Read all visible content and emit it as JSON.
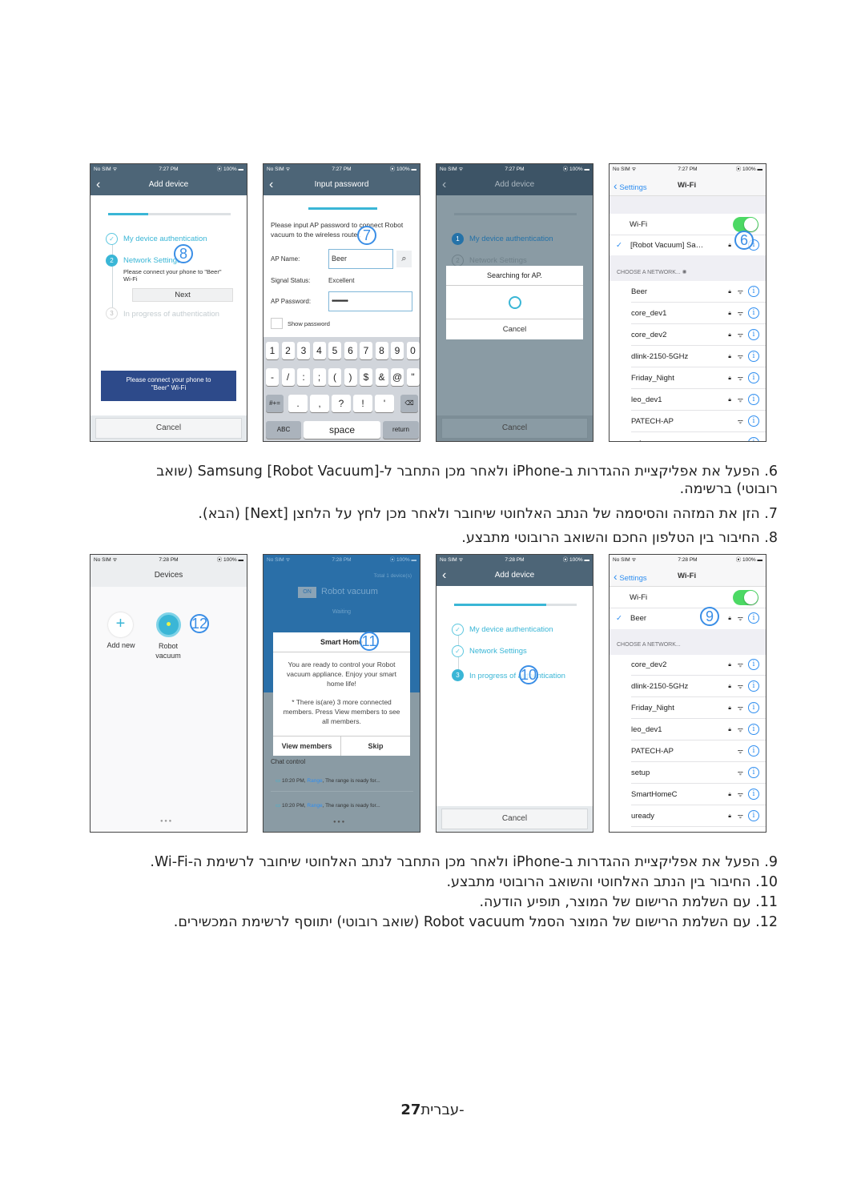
{
  "status": {
    "carrier": "No SIM ᯤ",
    "battery": "⦿ 100% ▬",
    "time1": "7:27 PM",
    "time2": "7:28 PM"
  },
  "p1": {
    "title": "Add device",
    "step1": "My device authentication",
    "step2": "Network Settings",
    "step2_sub": "Please connect your phone to \"Beer\" Wi-Fi",
    "next": "Next",
    "step3": "In progress of authentication",
    "connect_btn": "Please connect your phone to \"Beer\" Wi-Fi",
    "cancel": "Cancel",
    "marker": "8"
  },
  "p2": {
    "title": "Input password",
    "intro": "Please input AP password to connect Robot vacuum to the wireless router.",
    "ap_name_label": "AP Name:",
    "ap_name_value": "Beer",
    "signal_label": "Signal Status:",
    "signal_value": "Excellent",
    "ap_pw_label": "AP Password:",
    "ap_pw_value": "••••••••",
    "show_pw": "Show password",
    "marker": "7",
    "keys_row1": [
      "1",
      "2",
      "3",
      "4",
      "5",
      "6",
      "7",
      "8",
      "9",
      "0"
    ],
    "keys_row2": [
      "-",
      "/",
      ":",
      ";",
      "(",
      ")",
      "$",
      "&",
      "@",
      "\""
    ],
    "keys_row3": [
      ".",
      ",",
      "?",
      "!",
      "'"
    ],
    "key_sym": "#+=",
    "key_abc": "ABC",
    "key_space": "space",
    "key_return": "return",
    "key_delete": "⌫"
  },
  "p3": {
    "title": "Add device",
    "step1": "My device authentication",
    "step2": "Network Settings",
    "dialog_title": "Searching for AP.",
    "dialog_cancel": "Cancel",
    "cancel": "Cancel"
  },
  "p4": {
    "back": "Settings",
    "title": "Wi-Fi",
    "wifi_label": "Wi-Fi",
    "wifi_on": true,
    "connected": "[Robot Vacuum] Sa…",
    "section": "CHOOSE A NETWORK...",
    "marker": "6",
    "networks": [
      {
        "name": "Beer",
        "lock": true
      },
      {
        "name": "core_dev1",
        "lock": true
      },
      {
        "name": "core_dev2",
        "lock": true
      },
      {
        "name": "dlink-2150-5GHz",
        "lock": true
      },
      {
        "name": "Friday_Night",
        "lock": true
      },
      {
        "name": "leo_dev1",
        "lock": true
      },
      {
        "name": "PATECH-AP",
        "lock": false
      },
      {
        "name": "setup",
        "lock": false
      }
    ]
  },
  "p5": {
    "title": "Devices",
    "add_new": "Add new",
    "robot": "Robot vacuum",
    "marker": "12"
  },
  "p6": {
    "total": "Total 1 device(s)",
    "on_badge": "ON",
    "device": "Robot vacuum",
    "state": "Waiting",
    "dialog_title": "Smart Home",
    "msg1": "You are ready to control your Robot vacuum appliance. Enjoy your smart home life!",
    "msg2": "* There is(are) 3 more connected members. Press View members to see all members.",
    "view_members": "View members",
    "skip": "Skip",
    "chat": "Chat control",
    "chat1_time": "10:20 PM,",
    "chat1_from": "Range",
    "chat1_msg": ", The range is ready for...",
    "chat2_time": "10:20 PM,",
    "chat2_from": "Range",
    "chat2_msg": ", The range is ready for...",
    "marker": "11"
  },
  "p7": {
    "title": "Add device",
    "step1": "My device authentication",
    "step2": "Network Settings",
    "step3": "In progress of authentication",
    "cancel": "Cancel",
    "marker": "10"
  },
  "p8": {
    "back": "Settings",
    "title": "Wi-Fi",
    "wifi_label": "Wi-Fi",
    "wifi_on": true,
    "connected": "Beer",
    "section": "CHOOSE A NETWORK...",
    "marker": "9",
    "networks": [
      {
        "name": "core_dev2",
        "lock": true
      },
      {
        "name": "dlink-2150-5GHz",
        "lock": true
      },
      {
        "name": "Friday_Night",
        "lock": true
      },
      {
        "name": "leo_dev1",
        "lock": true
      },
      {
        "name": "PATECH-AP",
        "lock": false
      },
      {
        "name": "setup",
        "lock": false
      },
      {
        "name": "SmartHomeC",
        "lock": true
      },
      {
        "name": "uready",
        "lock": true
      }
    ]
  },
  "text": {
    "s6": "6. הפעל את אפליקציית ההגדרות ב-iPhone ולאחר מכן התחבר ל-[Robot Vacuum] Samsung (שואב רובוטי) ברשימה.",
    "s7": "7. הזן את המזהה והסיסמה של הנתב האלחוטי שיחובר ולאחר מכן לחץ על הלחצן [Next] (הבא).",
    "s8": "8. החיבור בין הטלפון החכם והשואב הרובוטי מתבצע.",
    "s9": "9. הפעל את אפליקציית ההגדרות ב-iPhone ולאחר מכן התחבר לנתב האלחוטי שיחובר לרשימת ה-Wi-Fi.",
    "s10": "10. החיבור בין הנתב האלחוטי והשואב הרובוטי מתבצע.",
    "s11": "11. עם השלמת הרישום של המוצר, תופיע הודעה.",
    "s12": "12. עם השלמת הרישום של המוצר הסמל Robot vacuum (שואב רובוטי) יתווסף לרשימת המכשירים."
  },
  "footer": {
    "page": "27",
    "lang": "-עברית"
  },
  "colors": {
    "accent": "#3ab6d6",
    "header": "#4d6577",
    "marker": "#3a8ee6",
    "ios_blue": "#2f8ef0",
    "toggle": "#4cd964",
    "connect_btn": "#2d4a8a"
  }
}
